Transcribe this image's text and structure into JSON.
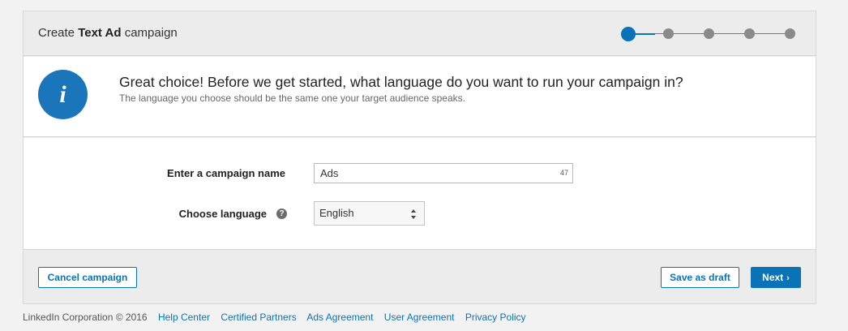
{
  "header": {
    "title_prefix": "Create ",
    "title_bold": "Text Ad",
    "title_suffix": " campaign",
    "progress": {
      "current_step": 1,
      "total_steps": 5
    }
  },
  "info": {
    "icon": "info-icon",
    "icon_glyph": "i",
    "headline": "Great choice! Before we get started, what language do you want to run your campaign in?",
    "subtext": "The language you choose should be the same one your target audience speaks."
  },
  "form": {
    "campaign_name_label": "Enter a campaign name",
    "campaign_name_value": "Ads",
    "campaign_name_remaining": "47",
    "language_label": "Choose language",
    "language_help_icon": "question-icon",
    "language_help_glyph": "?",
    "language_value": "English"
  },
  "actions": {
    "cancel_label": "Cancel campaign",
    "save_draft_label": "Save as draft",
    "next_label": "Next",
    "next_chevron": "›"
  },
  "footer": {
    "copyright": "LinkedIn Corporation © 2016",
    "links": [
      "Help Center",
      "Certified Partners",
      "Ads Agreement",
      "User Agreement",
      "Privacy Policy"
    ]
  },
  "colors": {
    "accent": "#0a73b7",
    "info_circle": "#1a75bb",
    "inactive_step": "#8a8a8a"
  }
}
